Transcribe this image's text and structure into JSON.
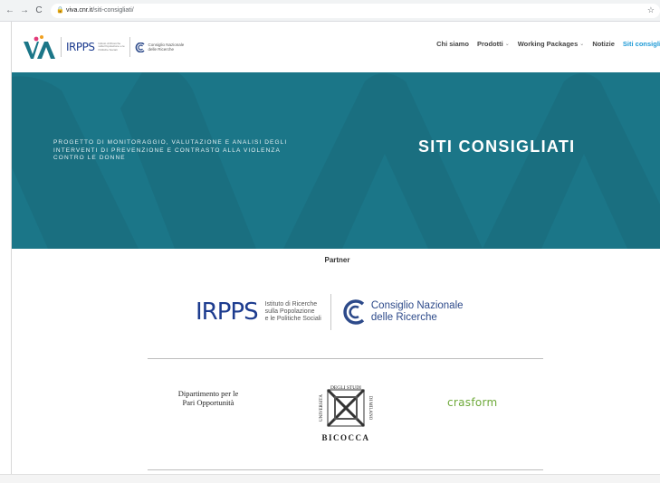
{
  "browser": {
    "url_host": "viva.cnr.it",
    "url_path": "/siti-consigliati/"
  },
  "header": {
    "irpps_small": "IRPPS",
    "irpps_small_text": "Istituto di Ricerche sulla Popolazione e le Politiche Sociali",
    "cnr_small_text_line1": "Consiglio Nazionale",
    "cnr_small_text_line2": "delle Ricerche",
    "menu": [
      {
        "label": "Chi siamo",
        "dropdown": false
      },
      {
        "label": "Prodotti",
        "dropdown": true
      },
      {
        "label": "Working Packages",
        "dropdown": true
      },
      {
        "label": "Notizie",
        "dropdown": false
      },
      {
        "label": "Siti consigli",
        "dropdown": false,
        "active": true
      }
    ]
  },
  "hero": {
    "tagline": "Progetto di monitoraggio, valutazione e analisi degli interventi di prevenzione e contrasto alla violenza contro le donne",
    "title": "SITI CONSIGLIATI"
  },
  "partners": {
    "title": "Partner",
    "irpps_brand": "IRPPS",
    "irpps_line1": "Istituto di Ricerche",
    "irpps_line2": "sulla Popolazione",
    "irpps_line3": "e le Politiche Sociali",
    "cnr_line1": "Consiglio Nazionale",
    "cnr_line2": "delle Ricerche",
    "dip_line1": "Dipartimento per le",
    "dip_line2": "Pari Opportunità",
    "bicocca_text": "UNIVERSITÀ DEGLI STUDI DI MILANO BICOCCA",
    "crasform": "crasform"
  },
  "colors": {
    "hero_bg": "#1b7688",
    "active_link": "#1e9ad6",
    "irpps_blue": "#1d3c8f",
    "crasform_green": "#6ea93a"
  }
}
